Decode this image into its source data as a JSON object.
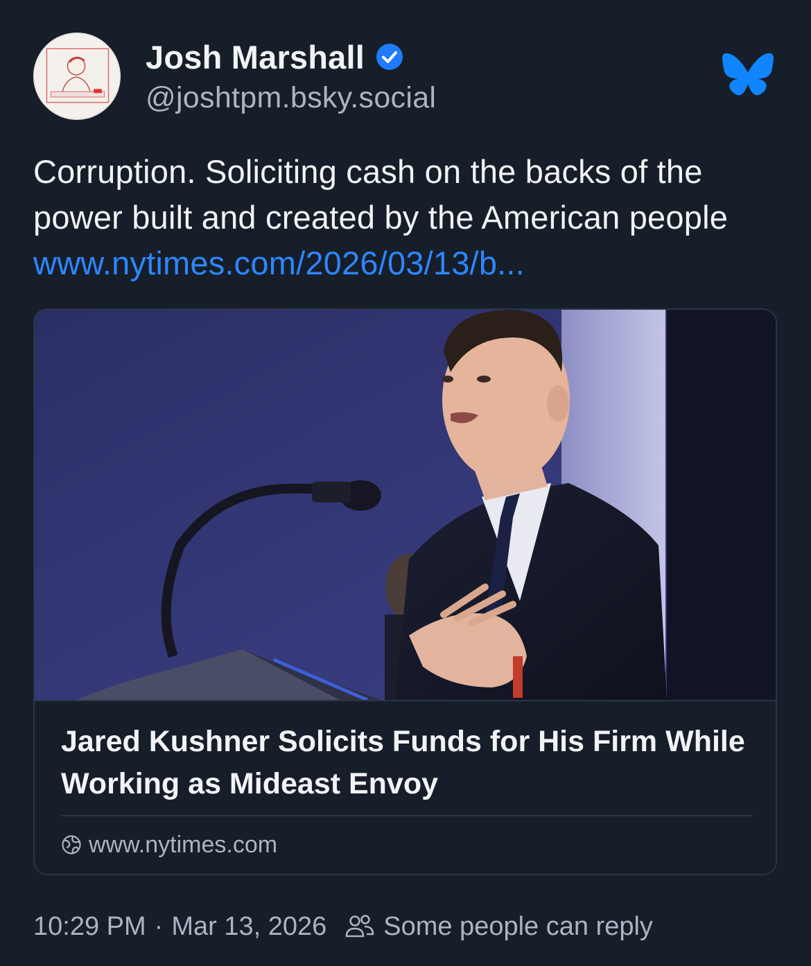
{
  "author": {
    "display_name": "Josh Marshall",
    "handle": "@joshtpm.bsky.social",
    "verified_icon": "verified-check-icon",
    "avatar_icon": "avatar-caricature"
  },
  "app": {
    "logo_icon": "bluesky-butterfly-icon",
    "accent_color": "#1185fe",
    "link_color": "#2e86ff",
    "background_color": "#161e29"
  },
  "post": {
    "text": "Corruption. Soliciting cash on the backs of the power built and created by the American people ",
    "link_text": "www.nytimes.com/2026/03/13/b..."
  },
  "link_card": {
    "image_description_icon": "article-photo",
    "title": "Jared Kushner Solicits Funds for His Firm While Working as Mideast Envoy",
    "domain": "www.nytimes.com",
    "domain_icon": "globe-icon"
  },
  "meta": {
    "time": "10:29 PM",
    "separator": "·",
    "date": "Mar 13, 2026",
    "reply_icon": "people-icon",
    "reply_setting": "Some people can reply"
  }
}
